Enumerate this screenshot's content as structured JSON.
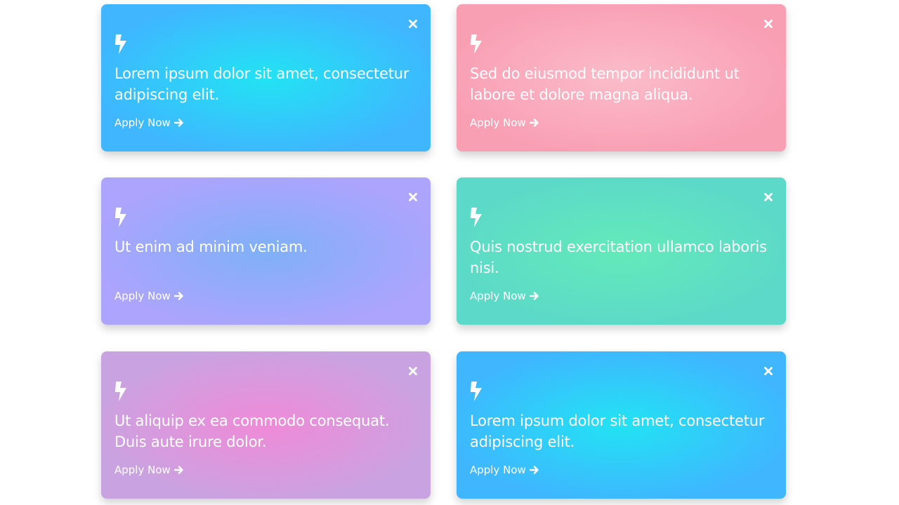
{
  "cards": [
    {
      "text": "Lorem ipsum dolor sit amet, consectetur adipiscing elit.",
      "link": "Apply Now",
      "gradient_center": "#22e3f3",
      "gradient_edge": "#3fb6ff"
    },
    {
      "text": "Sed do eiusmod tempor incididunt ut labore et dolore magna aliqua.",
      "link": "Apply Now",
      "gradient_center": "#fbbcca",
      "gradient_edge": "#f99fb4"
    },
    {
      "text": "Ut enim ad minim veniam.",
      "link": "Apply Now",
      "gradient_center": "#7fb0f8",
      "gradient_edge": "#aca4fd"
    },
    {
      "text": "Quis nostrud exercitation ullamco laboris nisi.",
      "link": "Apply Now",
      "gradient_center": "#63eab9",
      "gradient_edge": "#5cd9c9"
    },
    {
      "text": "Ut aliquip ex ea commodo consequat. Duis aute irure dolor.",
      "link": "Apply Now",
      "gradient_center": "#f08ad8",
      "gradient_edge": "#c9a3e1"
    },
    {
      "text": "Lorem ipsum dolor sit amet, consectetur adipiscing elit.",
      "link": "Apply Now",
      "gradient_center": "#22e3f3",
      "gradient_edge": "#3fb6ff"
    }
  ],
  "icons": {
    "card_icon": "lightning-bolt-icon",
    "close": "close-icon",
    "link_arrow": "arrow-right-icon"
  }
}
